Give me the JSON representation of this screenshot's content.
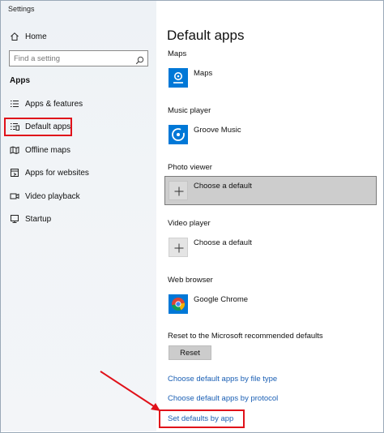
{
  "window": {
    "title": "Settings"
  },
  "sidebar": {
    "home_label": "Home",
    "search": {
      "placeholder": "Find a setting",
      "value": ""
    },
    "section_title": "Apps",
    "items": [
      {
        "label": "Apps & features",
        "icon": "list-icon"
      },
      {
        "label": "Default apps",
        "icon": "default-apps-icon",
        "selected": true
      },
      {
        "label": "Offline maps",
        "icon": "offline-maps-icon"
      },
      {
        "label": "Apps for websites",
        "icon": "apps-for-websites-icon"
      },
      {
        "label": "Video playback",
        "icon": "video-icon"
      },
      {
        "label": "Startup",
        "icon": "startup-icon"
      }
    ]
  },
  "main": {
    "title": "Default apps",
    "categories": [
      {
        "label": "Maps",
        "app": "Maps",
        "icon": "maps-app-icon",
        "color": "#0078d7"
      },
      {
        "label": "Music player",
        "app": "Groove Music",
        "icon": "groove-music-icon",
        "color": "#0078d7"
      },
      {
        "label": "Photo viewer",
        "app": "Choose a default",
        "icon": "plus-icon",
        "highlighted": true
      },
      {
        "label": "Video player",
        "app": "Choose a default",
        "icon": "plus-icon"
      },
      {
        "label": "Web browser",
        "app": "Google Chrome",
        "icon": "chrome-icon",
        "color": "#0078d7"
      }
    ],
    "reset": {
      "label": "Reset to the Microsoft recommended defaults",
      "button": "Reset"
    },
    "links": [
      "Choose default apps by file type",
      "Choose default apps by protocol",
      "Set defaults by app"
    ]
  },
  "annotation": {
    "color": "#e0111a"
  },
  "colors": {
    "accent": "#0078d7",
    "link": "#1a5fb4",
    "sidebar_bg": "#eef2f6"
  }
}
